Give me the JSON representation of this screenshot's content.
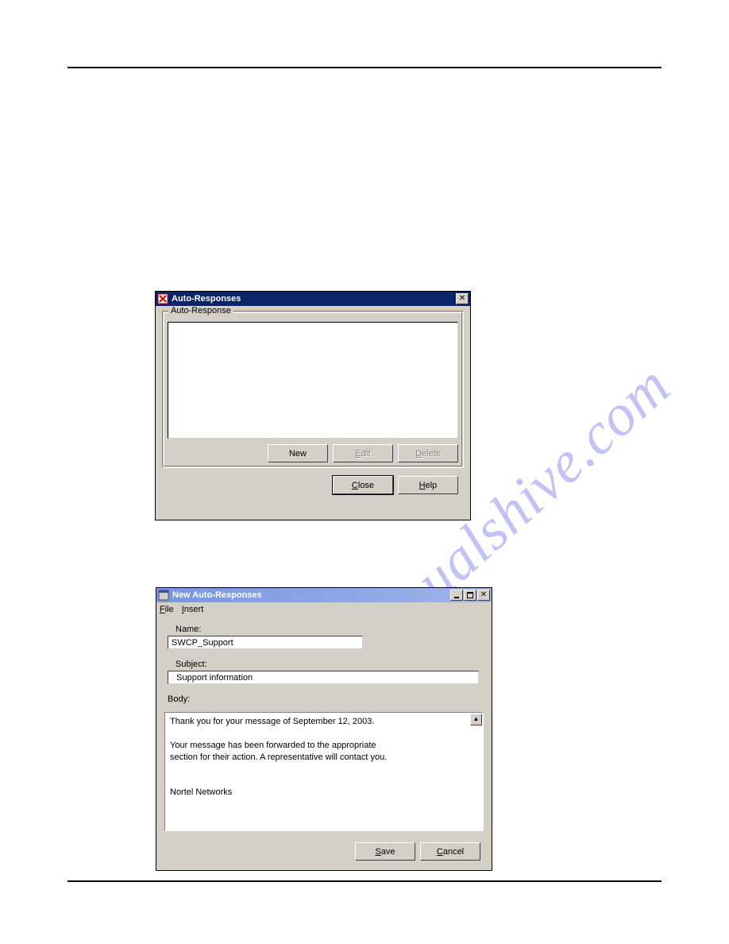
{
  "watermark": "manualshive.com",
  "dialog1": {
    "title": "Auto-Responses",
    "legend": "Auto-Response",
    "buttons": {
      "new": "New",
      "edit": "Edit",
      "delete": "Delete",
      "close": "Close",
      "help": "Help"
    }
  },
  "dialog2": {
    "title": "New Auto-Responses",
    "menu": {
      "file": "File",
      "insert": "Insert"
    },
    "labels": {
      "name": "Name:",
      "subject": "Subject:",
      "body": "Body:"
    },
    "fields": {
      "name": "SWCP_Support",
      "subject": "Support information"
    },
    "body_lines": [
      "Thank you for your message of September 12, 2003.",
      "",
      "Your message has been forwarded to the appropriate",
      "section for their action. A representative will contact you.",
      "",
      "",
      "Nortel Networks"
    ],
    "buttons": {
      "save": "Save",
      "cancel": "Cancel"
    }
  }
}
